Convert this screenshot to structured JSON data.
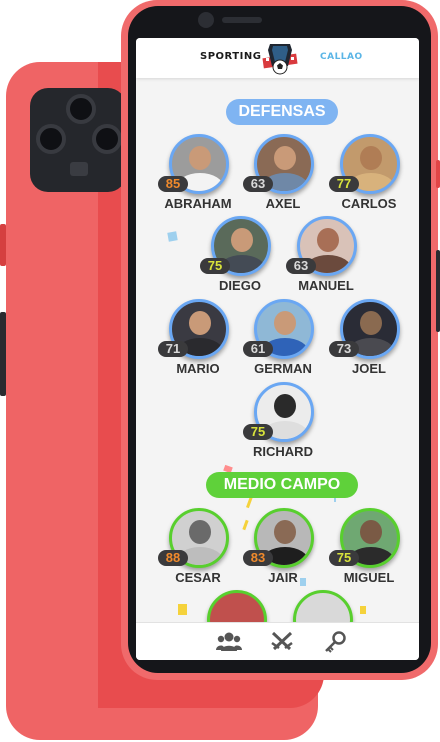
{
  "header": {
    "brand_left": "SPORTING",
    "brand_right": "CALLAO",
    "crest_icon": "soccer-crest-icon"
  },
  "sections": [
    {
      "key": "defensas",
      "title": "DEFENSAS",
      "color": "#7fb4f2",
      "players": [
        {
          "name": "ABRAHAM",
          "rating": "85",
          "rating_color": "#f08a2c"
        },
        {
          "name": "AXEL",
          "rating": "63",
          "rating_color": "#d9d9d9"
        },
        {
          "name": "CARLOS",
          "rating": "77",
          "rating_color": "#d8e23b"
        },
        {
          "name": "DIEGO",
          "rating": "75",
          "rating_color": "#d8e23b"
        },
        {
          "name": "MANUEL",
          "rating": "63",
          "rating_color": "#d9d9d9"
        },
        {
          "name": "MARIO",
          "rating": "71",
          "rating_color": "#d9d9d9"
        },
        {
          "name": "GERMAN",
          "rating": "61",
          "rating_color": "#d9d9d9"
        },
        {
          "name": "JOEL",
          "rating": "73",
          "rating_color": "#d9d9d9"
        },
        {
          "name": "RICHARD",
          "rating": "75",
          "rating_color": "#d8e23b"
        }
      ]
    },
    {
      "key": "medio",
      "title": "MEDIO CAMPO",
      "color": "#5fd13a",
      "players": [
        {
          "name": "CESAR",
          "rating": "88",
          "rating_color": "#f08a2c"
        },
        {
          "name": "JAIR",
          "rating": "83",
          "rating_color": "#f08a2c"
        },
        {
          "name": "MIGUEL",
          "rating": "75",
          "rating_color": "#d8e23b"
        }
      ]
    }
  ],
  "bottom_nav": [
    {
      "icon": "players-group-icon"
    },
    {
      "icon": "crossed-swords-icon"
    },
    {
      "icon": "key-icon"
    }
  ]
}
